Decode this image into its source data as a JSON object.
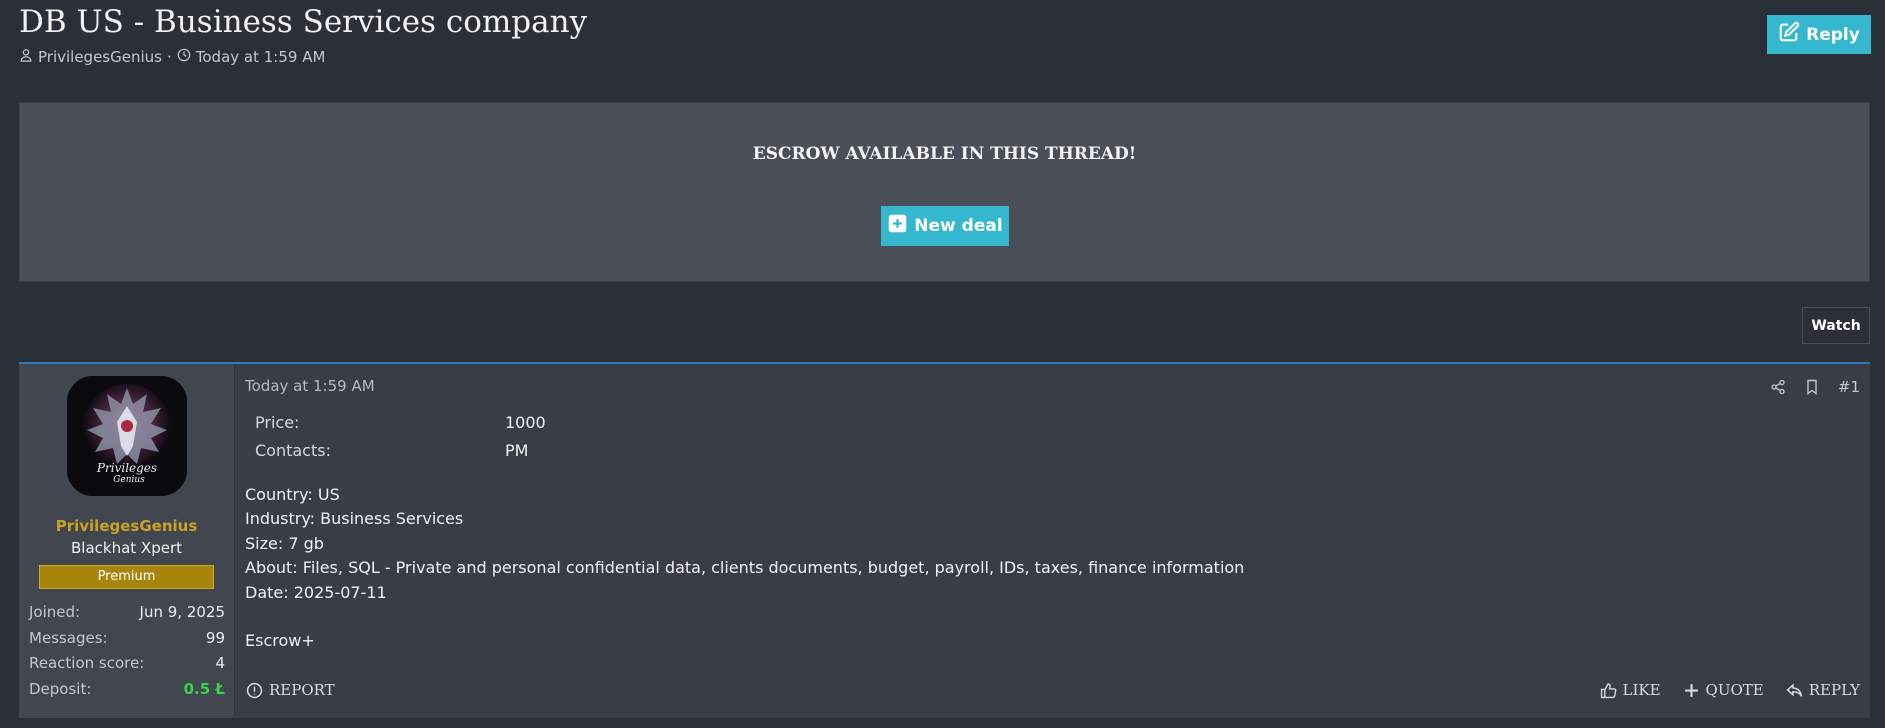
{
  "thread": {
    "title": "DB US - Business Services company",
    "author": "PrivilegesGenius",
    "separator": "·",
    "time": "Today at 1:59 AM",
    "reply_label": "Reply"
  },
  "escrow": {
    "title": "ESCROW AVAILABLE IN THIS THREAD!",
    "new_deal_label": "New deal"
  },
  "watch_label": "Watch",
  "post": {
    "user": {
      "name": "PrivilegesGenius",
      "title": "Blackhat Xpert",
      "badge": "Premium",
      "avatar_text_1": "Privileges",
      "avatar_text_2": "Genius",
      "stats": [
        {
          "label": "Joined:",
          "value": "Jun 9, 2025"
        },
        {
          "label": "Messages:",
          "value": "99"
        },
        {
          "label": "Reaction score:",
          "value": "4"
        },
        {
          "label": "Deposit:",
          "value": "0.5 Ł"
        }
      ]
    },
    "date": "Today at 1:59 AM",
    "number": "#1",
    "fields": [
      {
        "label": "Price:",
        "value": "1000"
      },
      {
        "label": "Contacts:",
        "value": "PM"
      }
    ],
    "lines": [
      "Country: US",
      "Industry: Business Services",
      "Size: 7 gb",
      "About: Files, SQL - Private and personal confidential data, clients documents, budget, payroll, IDs, taxes, finance information",
      "Date: 2025-07-11",
      "",
      "Escrow+"
    ],
    "actions": {
      "report": "REPORT",
      "like": "LIKE",
      "quote": "QUOTE",
      "reply": "REPLY"
    }
  },
  "colors": {
    "accent": "#35b8cf",
    "username": "#c9a227",
    "premium": "#a8850c",
    "deposit": "#3bd14a",
    "post_border": "#2f7ab8"
  },
  "icons": [
    "user-icon",
    "clock-icon",
    "edit-icon",
    "plus-square-icon",
    "share-icon",
    "bookmark-icon",
    "info-circle-icon",
    "thumbs-up-icon",
    "plus-icon",
    "reply-arrow-icon"
  ]
}
